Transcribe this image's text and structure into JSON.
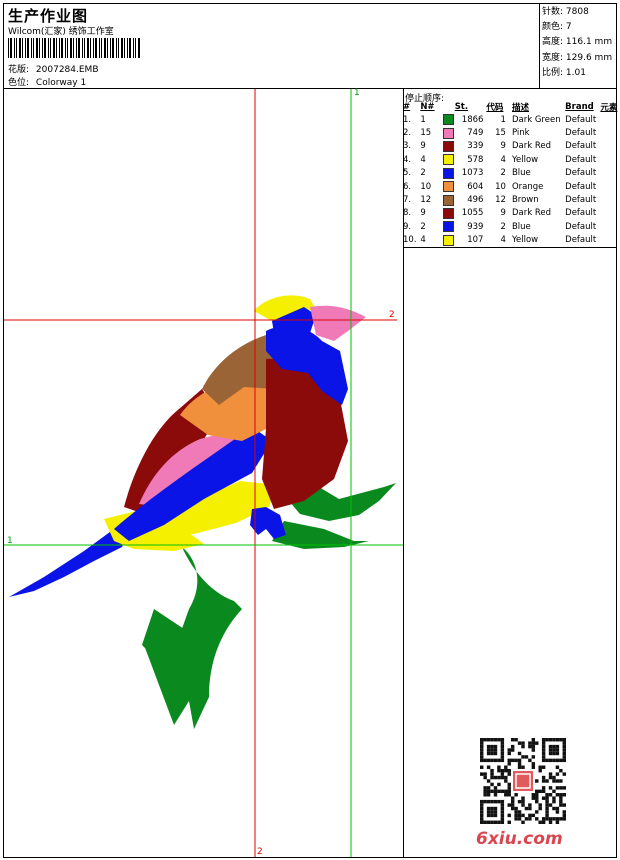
{
  "header": {
    "title": "生产作业图",
    "company": "Wilcom(汇家) 绣饰工作室",
    "design_label": "花版:",
    "design_value": "2007284.EMB",
    "colorway_label": "色位:",
    "colorway_value": "Colorway 1"
  },
  "stats": [
    {
      "label": "针数:",
      "value": "7808"
    },
    {
      "label": "颜色:",
      "value": "7"
    },
    {
      "label": "高度:",
      "value": "116.1 mm"
    },
    {
      "label": "宽度:",
      "value": "129.6 mm"
    },
    {
      "label": "比例:",
      "value": "1.01"
    }
  ],
  "stop_sequence": {
    "title": "停止顺序:",
    "columns": [
      "#",
      "N#",
      "St.",
      "代码",
      "描述",
      "Brand",
      "元素"
    ],
    "rows": [
      {
        "idx": "1.",
        "n": "1",
        "color": "#0a8a1e",
        "st": "1866",
        "code": "1",
        "desc": "Dark Green",
        "brand": "Default"
      },
      {
        "idx": "2.",
        "n": "15",
        "color": "#f07ab8",
        "st": "749",
        "code": "15",
        "desc": "Pink",
        "brand": "Default"
      },
      {
        "idx": "3.",
        "n": "9",
        "color": "#8b0a0a",
        "st": "339",
        "code": "9",
        "desc": "Dark Red",
        "brand": "Default"
      },
      {
        "idx": "4.",
        "n": "4",
        "color": "#f5f000",
        "st": "578",
        "code": "4",
        "desc": "Yellow",
        "brand": "Default"
      },
      {
        "idx": "5.",
        "n": "2",
        "color": "#0a14e6",
        "st": "1073",
        "code": "2",
        "desc": "Blue",
        "brand": "Default"
      },
      {
        "idx": "6.",
        "n": "10",
        "color": "#f0903c",
        "st": "604",
        "code": "10",
        "desc": "Orange",
        "brand": "Default"
      },
      {
        "idx": "7.",
        "n": "12",
        "color": "#9a6436",
        "st": "496",
        "code": "12",
        "desc": "Brown",
        "brand": "Default"
      },
      {
        "idx": "8.",
        "n": "9",
        "color": "#8b0a0a",
        "st": "1055",
        "code": "9",
        "desc": "Dark Red",
        "brand": "Default"
      },
      {
        "idx": "9.",
        "n": "2",
        "color": "#0a14e6",
        "st": "939",
        "code": "2",
        "desc": "Blue",
        "brand": "Default"
      },
      {
        "idx": "10.",
        "n": "4",
        "color": "#f5f000",
        "st": "107",
        "code": "4",
        "desc": "Yellow",
        "brand": "Default"
      }
    ]
  },
  "guides": {
    "h1": "1",
    "v1": "1",
    "h2": "2",
    "v2": "2",
    "red_color": "#e00000",
    "green_color": "#00c000"
  },
  "watermark": "6xiu.com"
}
